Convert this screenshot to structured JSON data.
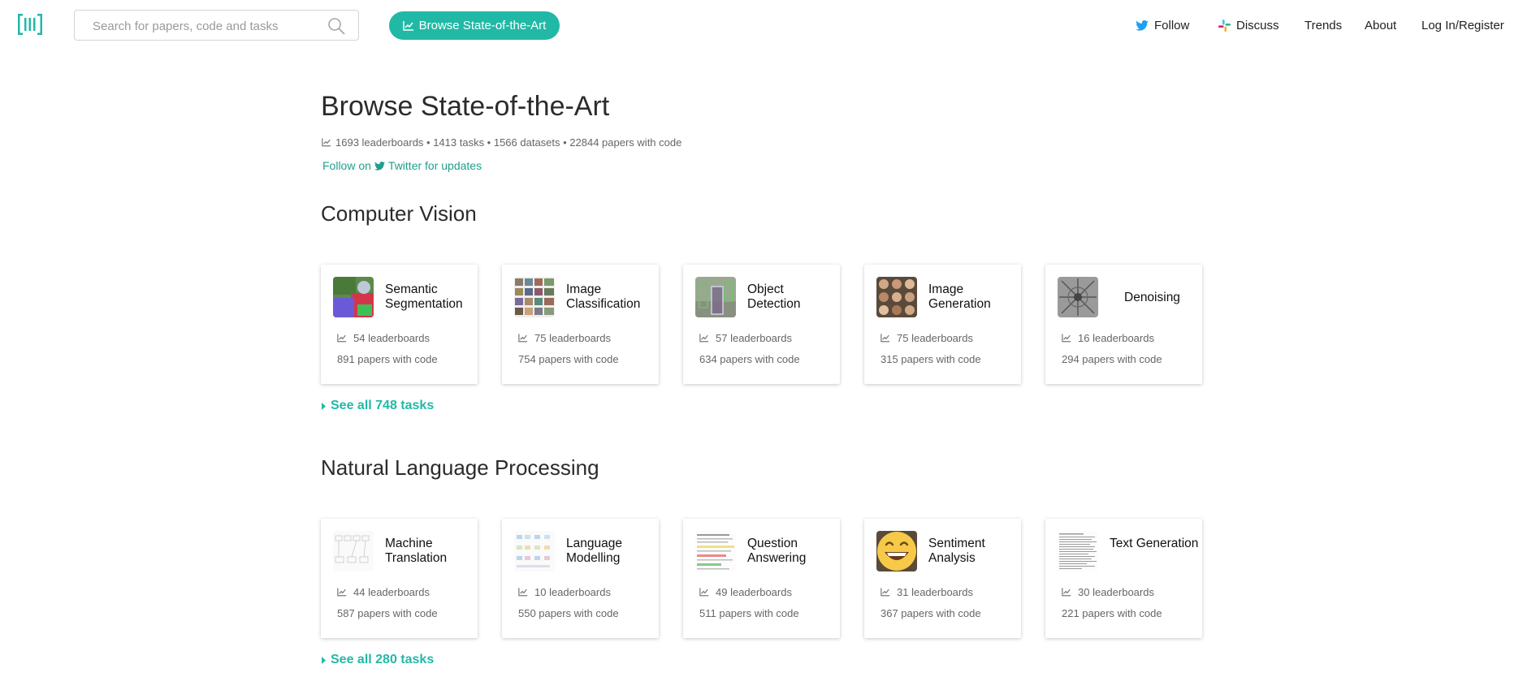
{
  "nav": {
    "search_placeholder": "Search for papers, code and tasks",
    "browse_label": "Browse State-of-the-Art",
    "follow_label": "Follow",
    "discuss_label": "Discuss",
    "trends_label": "Trends",
    "about_label": "About",
    "login_label": "Log In/Register"
  },
  "header": {
    "title": "Browse State-of-the-Art",
    "stats": "1693 leaderboards • 1413 tasks • 1566 datasets • 22844 papers with code",
    "follow_prefix": "Follow on",
    "follow_link": "Twitter for updates"
  },
  "sections": [
    {
      "title": "Computer Vision",
      "see_all": "See all 748 tasks",
      "cards": [
        {
          "name": "Semantic Segmentation",
          "leaderboards": "54 leaderboards",
          "papers": "891 papers with code"
        },
        {
          "name": "Image Classification",
          "leaderboards": "75 leaderboards",
          "papers": "754 papers with code"
        },
        {
          "name": "Object Detection",
          "leaderboards": "57 leaderboards",
          "papers": "634 papers with code"
        },
        {
          "name": "Image Generation",
          "leaderboards": "75 leaderboards",
          "papers": "315 papers with code"
        },
        {
          "name": "Denoising",
          "leaderboards": "16 leaderboards",
          "papers": "294 papers with code"
        }
      ]
    },
    {
      "title": "Natural Language Processing",
      "see_all": "See all 280 tasks",
      "cards": [
        {
          "name": "Machine Translation",
          "leaderboards": "44 leaderboards",
          "papers": "587 papers with code"
        },
        {
          "name": "Language Modelling",
          "leaderboards": "10 leaderboards",
          "papers": "550 papers with code"
        },
        {
          "name": "Question Answering",
          "leaderboards": "49 leaderboards",
          "papers": "511 papers with code"
        },
        {
          "name": "Sentiment Analysis",
          "leaderboards": "31 leaderboards",
          "papers": "367 papers with code"
        },
        {
          "name": "Text Generation",
          "leaderboards": "30 leaderboards",
          "papers": "221 papers with code"
        }
      ]
    }
  ],
  "colors": {
    "accent": "#21b9a6",
    "link": "#1f9e8c",
    "twitter": "#1da1f2"
  }
}
